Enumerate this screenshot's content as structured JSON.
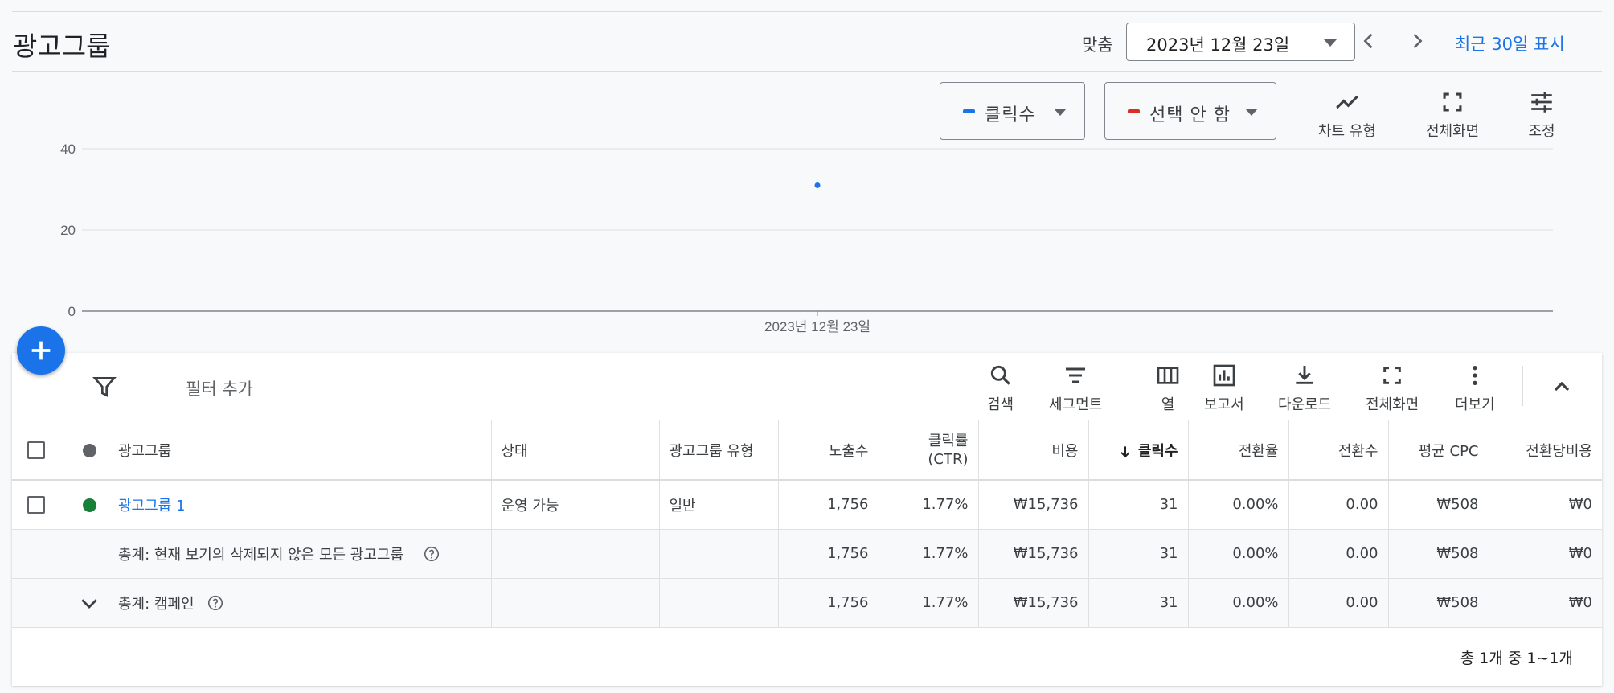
{
  "header": {
    "title": "광고그룹",
    "range_label": "맞춤",
    "date_value": "2023년 12월 23일",
    "recent_link": "최근 30일 표시"
  },
  "chart": {
    "metric1": {
      "label": "클릭수",
      "color": "#1a73e8"
    },
    "metric2": {
      "label": "선택 안 함",
      "color": "#d93025"
    },
    "tools": {
      "chart_type": "차트 유형",
      "fullscreen": "전체화면",
      "adjust": "조정"
    }
  },
  "chart_data": {
    "type": "scatter",
    "x": [
      "2023년 12월 23일"
    ],
    "series": [
      {
        "name": "클릭수",
        "values": [
          31
        ]
      }
    ],
    "yticks": [
      "0",
      "20",
      "40"
    ],
    "ylim": [
      0,
      40
    ],
    "xtick_label": "2023년 12월 23일",
    "grid": true
  },
  "toolbar": {
    "filter_add": "필터 추가",
    "search": "검색",
    "segment": "세그먼트",
    "columns": "열",
    "report": "보고서",
    "download": "다운로드",
    "fullscreen": "전체화면",
    "more": "더보기"
  },
  "table": {
    "headers": {
      "adgroup": "광고그룹",
      "status": "상태",
      "type": "광고그룹 유형",
      "impressions": "노출수",
      "ctr_line1": "클릭률",
      "ctr_line2": "(CTR)",
      "cost": "비용",
      "clicks": "클릭수",
      "conv_rate": "전환율",
      "conversions": "전환수",
      "avg_cpc": "평균 CPC",
      "cost_per_conv": "전환당비용"
    },
    "row": {
      "name": "광고그룹 1",
      "status": "운영 가능",
      "type": "일반",
      "impressions": "1,756",
      "ctr": "1.77%",
      "cost": "₩15,736",
      "clicks": "31",
      "conv_rate": "0.00%",
      "conversions": "0.00",
      "avg_cpc": "₩508",
      "cost_per_conv": "₩0"
    },
    "total_view": {
      "label": "총계: 현재 보기의 삭제되지 않은 모든 광고그룹",
      "impressions": "1,756",
      "ctr": "1.77%",
      "cost": "₩15,736",
      "clicks": "31",
      "conv_rate": "0.00%",
      "conversions": "0.00",
      "avg_cpc": "₩508",
      "cost_per_conv": "₩0"
    },
    "total_campaign": {
      "label": "총계: 캠페인",
      "impressions": "1,756",
      "ctr": "1.77%",
      "cost": "₩15,736",
      "clicks": "31",
      "conv_rate": "0.00%",
      "conversions": "0.00",
      "avg_cpc": "₩508",
      "cost_per_conv": "₩0"
    },
    "pager": "총 1개 중 1~1개"
  },
  "colors": {
    "accent": "#1a73e8",
    "enabled": "#188038",
    "header_dot": "#5f6368"
  }
}
